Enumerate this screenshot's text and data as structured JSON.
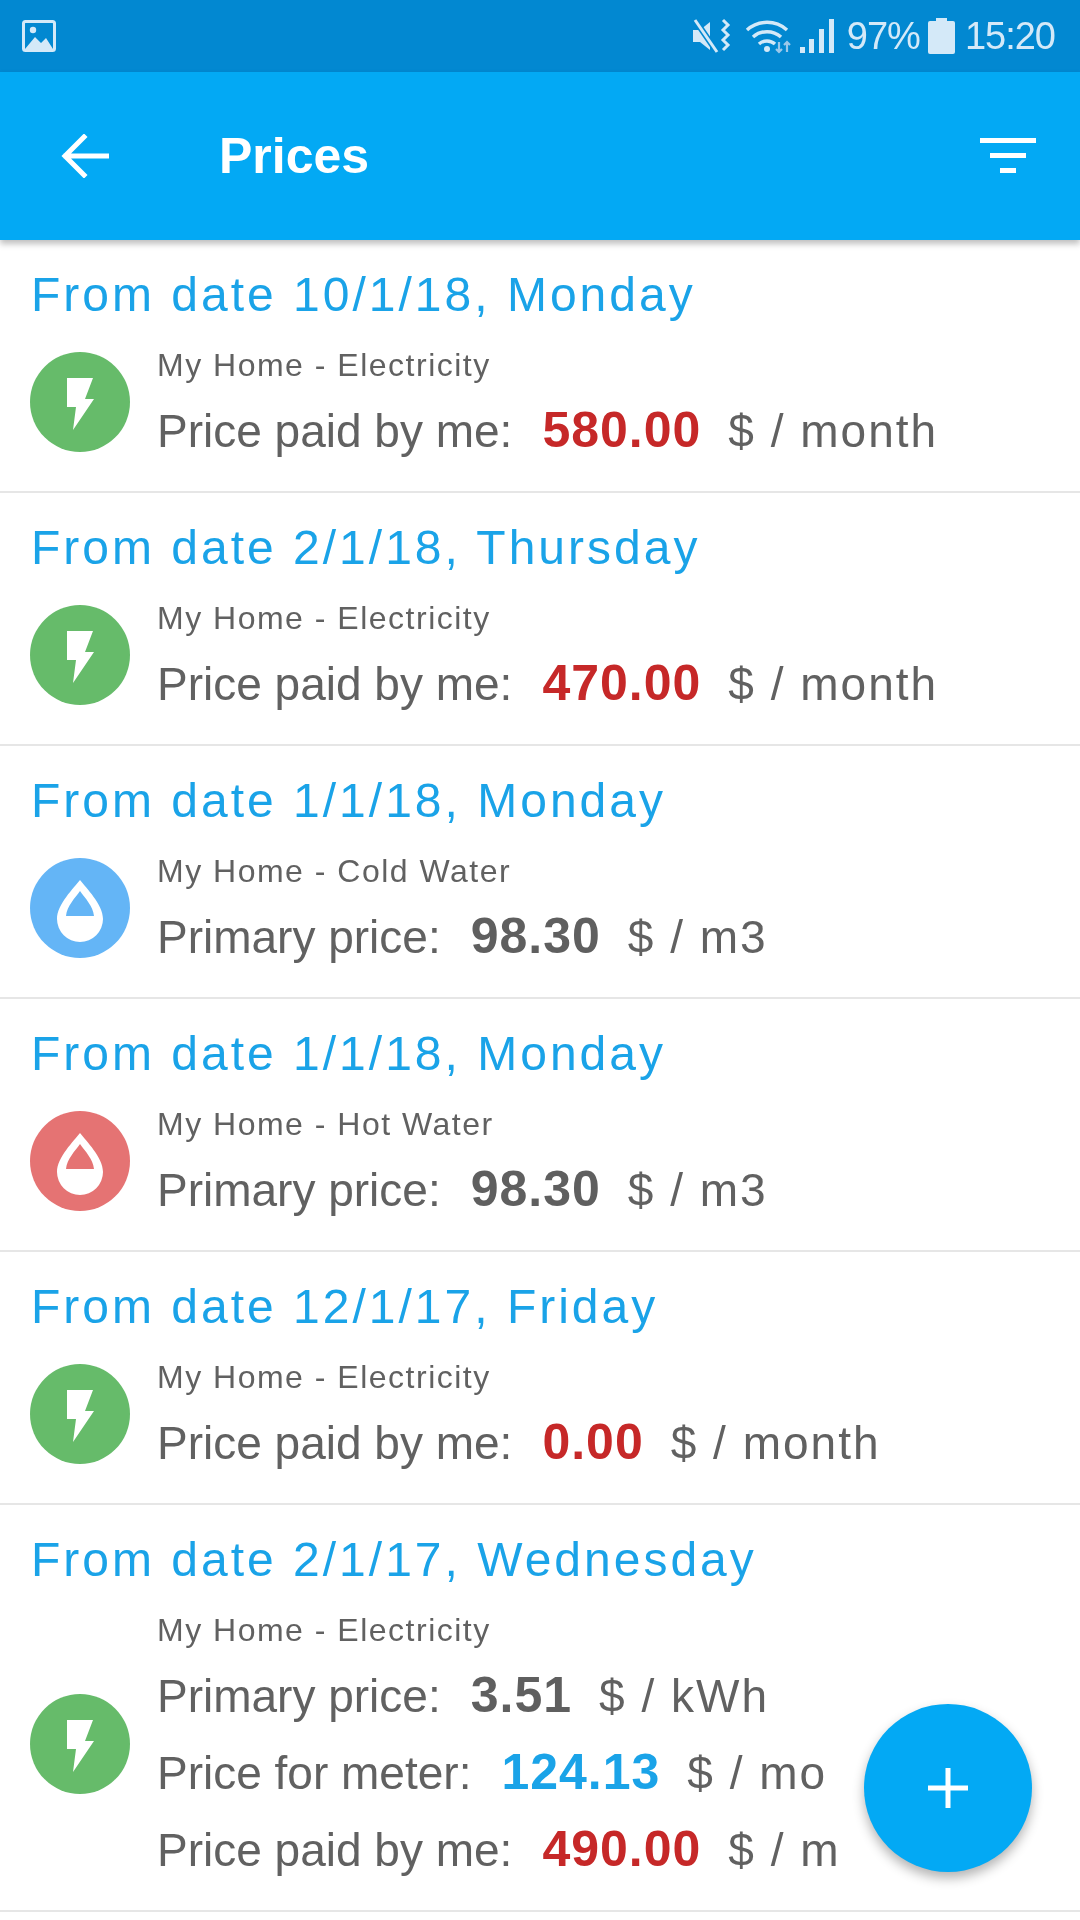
{
  "status_bar": {
    "battery": "97%",
    "time": "15:20"
  },
  "app_bar": {
    "title": "Prices"
  },
  "items": [
    {
      "date": "From date 10/1/18, Monday",
      "meter": "My Home - Electricity",
      "icon": {
        "kind": "bolt",
        "color": "#66bb6a"
      },
      "prices": [
        {
          "kind": "paid",
          "label": "Price paid by me:",
          "value": "580.00",
          "unit": "$ / month"
        }
      ]
    },
    {
      "date": "From date 2/1/18, Thursday",
      "meter": "My Home - Electricity",
      "icon": {
        "kind": "bolt",
        "color": "#66bb6a"
      },
      "prices": [
        {
          "kind": "paid",
          "label": "Price paid by me:",
          "value": "470.00",
          "unit": "$ / month"
        }
      ]
    },
    {
      "date": "From date 1/1/18, Monday",
      "meter": "My Home - Cold Water",
      "icon": {
        "kind": "drop",
        "color": "#64b5f6"
      },
      "prices": [
        {
          "kind": "primary",
          "label": "Primary price:",
          "value": "98.30",
          "unit": "$ / m3"
        }
      ]
    },
    {
      "date": "From date 1/1/18, Monday",
      "meter": "My Home - Hot Water",
      "icon": {
        "kind": "drop",
        "color": "#e57373"
      },
      "prices": [
        {
          "kind": "primary",
          "label": "Primary price:",
          "value": "98.30",
          "unit": "$ / m3"
        }
      ]
    },
    {
      "date": "From date 12/1/17, Friday",
      "meter": "My Home - Electricity",
      "icon": {
        "kind": "bolt",
        "color": "#66bb6a"
      },
      "prices": [
        {
          "kind": "paid",
          "label": "Price paid by me:",
          "value": "0.00",
          "unit": "$ / month"
        }
      ]
    },
    {
      "date": "From date 2/1/17, Wednesday",
      "meter": "My Home - Electricity",
      "icon": {
        "kind": "bolt",
        "color": "#66bb6a"
      },
      "prices": [
        {
          "kind": "primary",
          "label": "Primary price:",
          "value": "3.51",
          "unit": "$ / kWh"
        },
        {
          "kind": "meter",
          "label": "Price for meter:",
          "value": "124.13",
          "unit": "$ / mo"
        },
        {
          "kind": "paid",
          "label": "Price paid by me:",
          "value": "490.00",
          "unit": "$ / m"
        }
      ]
    }
  ]
}
